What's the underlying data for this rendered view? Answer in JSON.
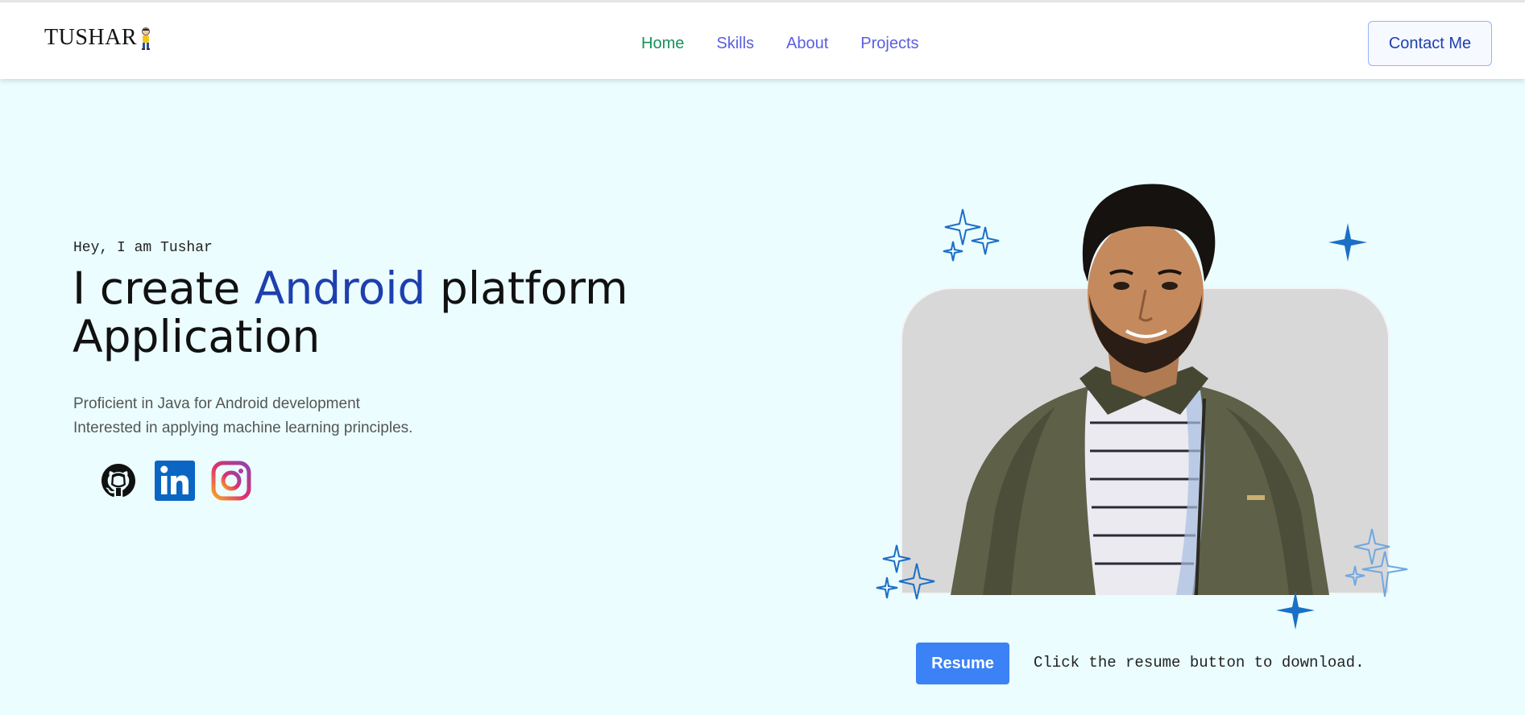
{
  "navbar": {
    "logo_text": "TUSHAR",
    "links": [
      {
        "label": "Home"
      },
      {
        "label": "Skills"
      },
      {
        "label": "About"
      },
      {
        "label": "Projects"
      }
    ],
    "contact_label": "Contact Me"
  },
  "hero": {
    "greeting": "Hey, I am Tushar",
    "headline_part1": "I create ",
    "headline_accent": "Android",
    "headline_part2": " platform Application",
    "desc_line1": "Proficient in Java for Android development",
    "desc_line2": "Interested in applying machine learning principles."
  },
  "socials": [
    {
      "name": "github-icon"
    },
    {
      "name": "linkedin-icon"
    },
    {
      "name": "instagram-icon"
    }
  ],
  "resume": {
    "button_label": "Resume",
    "note": "Click the resume button to download."
  },
  "colors": {
    "background": "#ebfdfe",
    "nav_active": "#15925a",
    "nav_link": "#5a5fe0",
    "accent": "#1e3fae",
    "resume_button": "#3b82f6",
    "sparkle": "#1b6fc7"
  }
}
